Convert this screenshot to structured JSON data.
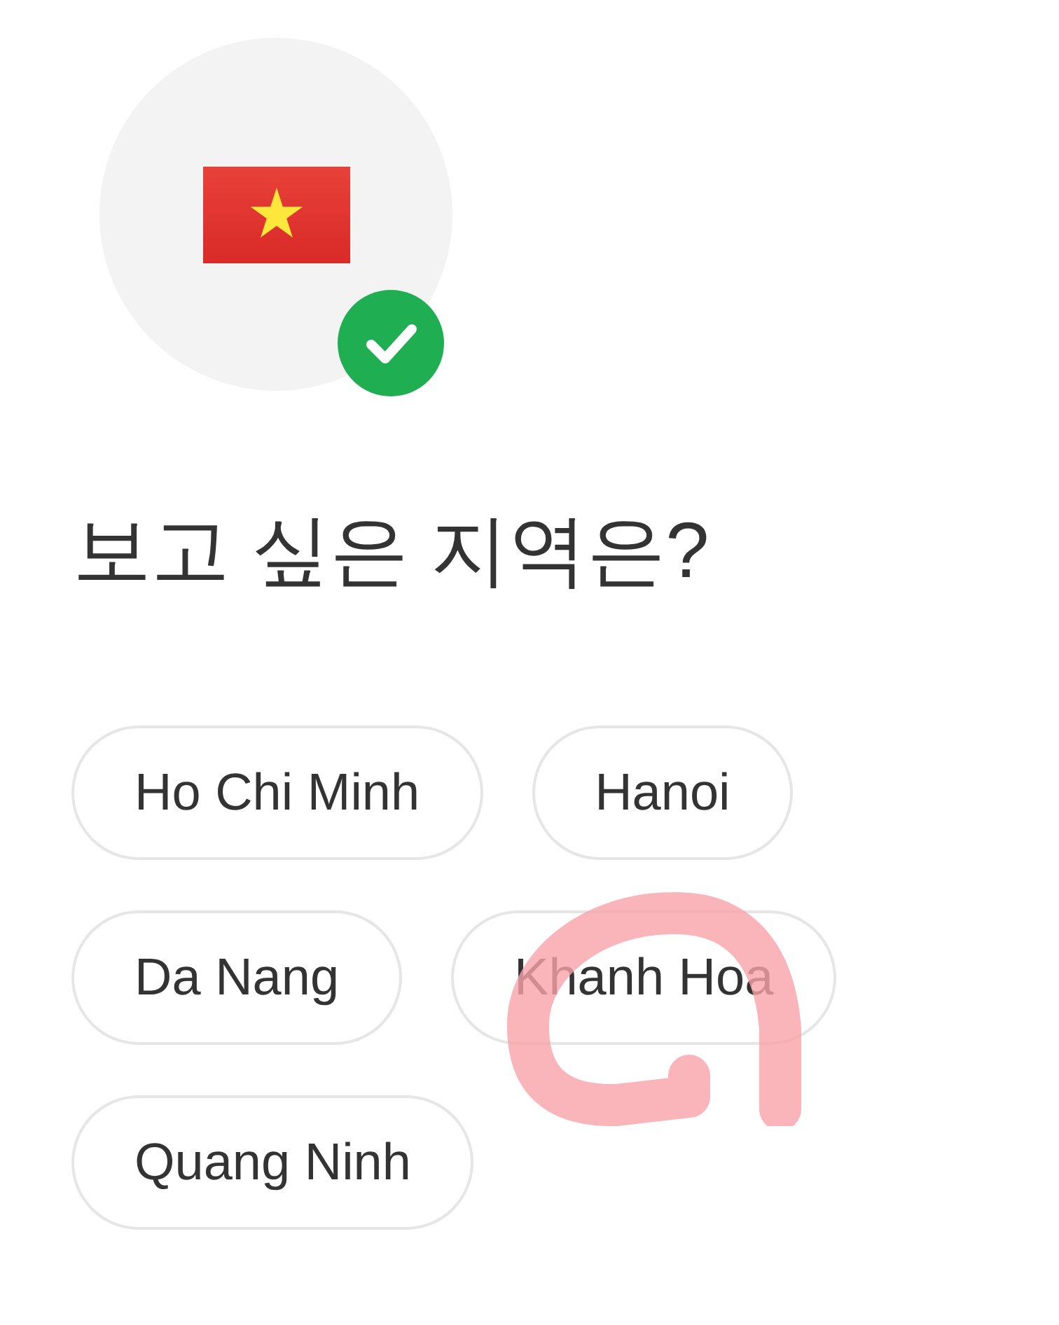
{
  "country_avatar": {
    "checked": true
  },
  "heading": "보고 싶은 지역은?",
  "regions": [
    {
      "label": "Ho Chi Minh",
      "selected": false
    },
    {
      "label": "Hanoi",
      "selected": false
    },
    {
      "label": "Da Nang",
      "selected": false
    },
    {
      "label": "Khanh Hoa",
      "selected": false
    },
    {
      "label": "Quang Ninh",
      "selected": false
    }
  ]
}
